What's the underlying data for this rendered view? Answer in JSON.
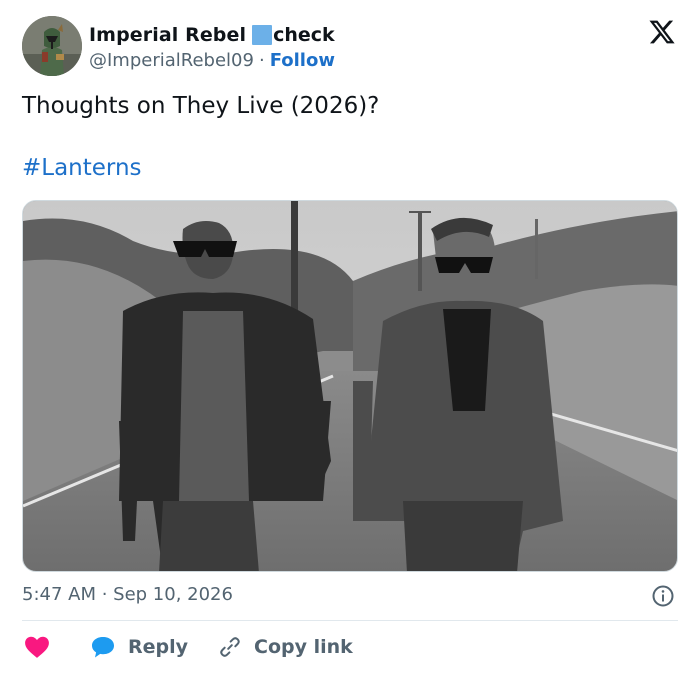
{
  "author": {
    "display_name": "Imperial Rebel",
    "verified_label": "check",
    "handle": "@ImperialRebel09",
    "separator": "·",
    "follow_label": "Follow"
  },
  "tweet": {
    "text": "Thoughts on They Live (2026)?",
    "hashtag": "#Lanterns",
    "timestamp": "5:47 AM · Sep 10, 2026"
  },
  "actions": {
    "like_icon": "heart-icon",
    "reply_label": "Reply",
    "copy_link_label": "Copy link"
  },
  "icons": {
    "platform": "x-logo-icon",
    "info": "info-icon",
    "reply": "speech-bubble-icon",
    "link": "link-icon"
  },
  "colors": {
    "link_blue": "#1d70c9",
    "heart_pink": "#f91880",
    "reply_blue": "#1d9bf0",
    "muted_text": "#536471",
    "verified_square": "#6cb0e8"
  }
}
